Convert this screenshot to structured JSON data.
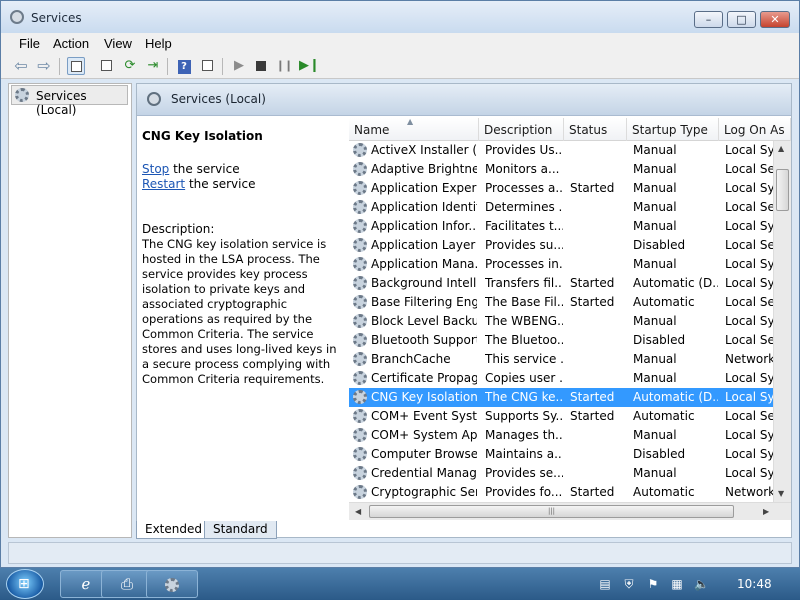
{
  "window": {
    "title": "Services",
    "minimize_glyph": "–",
    "maximize_glyph": "□",
    "close_glyph": "✕"
  },
  "menu": [
    "File",
    "Action",
    "View",
    "Help"
  ],
  "toolbar_icons": [
    "back-arrow-icon",
    "forward-arrow-icon",
    "console-tree-icon",
    "properties-icon",
    "refresh-icon",
    "export-icon",
    "help-icon",
    "show-hide-pane-icon",
    "start-service-icon",
    "stop-service-icon",
    "pause-service-icon",
    "restart-service-icon"
  ],
  "tree": {
    "root_label": "Services (Local)"
  },
  "pane": {
    "header": "Services (Local)",
    "selected_service": "CNG Key Isolation",
    "actions": {
      "stop_link": "Stop",
      "stop_rest": " the service",
      "restart_link": "Restart",
      "restart_rest": " the service"
    },
    "description_label": "Description:",
    "description": "The CNG key isolation service is hosted in the LSA process. The service provides key process isolation to private keys and associated cryptographic operations as required by the Common Criteria. The service stores and uses long-lived keys in a secure process complying with Common Criteria requirements."
  },
  "columns": [
    "Name",
    "Description",
    "Status",
    "Startup Type",
    "Log On As"
  ],
  "rows": [
    {
      "name": "ActiveX Installer (...",
      "desc": "Provides Us...",
      "status": "",
      "startup": "Manual",
      "logon": "Local Syst"
    },
    {
      "name": "Adaptive Brightness",
      "desc": "Monitors a...",
      "status": "",
      "startup": "Manual",
      "logon": "Local Serv"
    },
    {
      "name": "Application Experi...",
      "desc": "Processes a...",
      "status": "Started",
      "startup": "Manual",
      "logon": "Local Syst"
    },
    {
      "name": "Application Identity",
      "desc": "Determines ...",
      "status": "",
      "startup": "Manual",
      "logon": "Local Serv"
    },
    {
      "name": "Application Infor...",
      "desc": "Facilitates t...",
      "status": "",
      "startup": "Manual",
      "logon": "Local Syst"
    },
    {
      "name": "Application Layer ...",
      "desc": "Provides su...",
      "status": "",
      "startup": "Disabled",
      "logon": "Local Serv"
    },
    {
      "name": "Application Mana...",
      "desc": "Processes in...",
      "status": "",
      "startup": "Manual",
      "logon": "Local Syst"
    },
    {
      "name": "Background Intelli...",
      "desc": "Transfers fil...",
      "status": "Started",
      "startup": "Automatic (D...",
      "logon": "Local Syst"
    },
    {
      "name": "Base Filtering Engi...",
      "desc": "The Base Fil...",
      "status": "Started",
      "startup": "Automatic",
      "logon": "Local Serv"
    },
    {
      "name": "Block Level Backu...",
      "desc": "The WBENG...",
      "status": "",
      "startup": "Manual",
      "logon": "Local Syst"
    },
    {
      "name": "Bluetooth Support...",
      "desc": "The Bluetoo...",
      "status": "",
      "startup": "Disabled",
      "logon": "Local Serv"
    },
    {
      "name": "BranchCache",
      "desc": "This service ...",
      "status": "",
      "startup": "Manual",
      "logon": "Network S"
    },
    {
      "name": "Certificate Propag...",
      "desc": "Copies user ...",
      "status": "",
      "startup": "Manual",
      "logon": "Local Syst"
    },
    {
      "name": "CNG Key Isolation",
      "desc": "The CNG ke...",
      "status": "Started",
      "startup": "Automatic (D...",
      "logon": "Local Syst"
    },
    {
      "name": "COM+ Event Syst...",
      "desc": "Supports Sy...",
      "status": "Started",
      "startup": "Automatic",
      "logon": "Local Serv"
    },
    {
      "name": "COM+ System Ap...",
      "desc": "Manages th...",
      "status": "",
      "startup": "Manual",
      "logon": "Local Syst"
    },
    {
      "name": "Computer Browser",
      "desc": "Maintains a...",
      "status": "",
      "startup": "Disabled",
      "logon": "Local Syst"
    },
    {
      "name": "Credential Manager",
      "desc": "Provides se...",
      "status": "",
      "startup": "Manual",
      "logon": "Local Syst"
    },
    {
      "name": "Cryptographic Ser...",
      "desc": "Provides fo...",
      "status": "Started",
      "startup": "Automatic",
      "logon": "Network S"
    }
  ],
  "selected_row_index": 13,
  "tabs": [
    "Extended",
    "Standard"
  ],
  "taskbar": {
    "start_icon": "windows-logo-icon",
    "buttons": [
      "internet-explorer-icon",
      "printer-icon",
      "services-icon"
    ],
    "clock": "10:48"
  },
  "colors": {
    "selection": "#3399ff",
    "link": "#1c56b4"
  }
}
